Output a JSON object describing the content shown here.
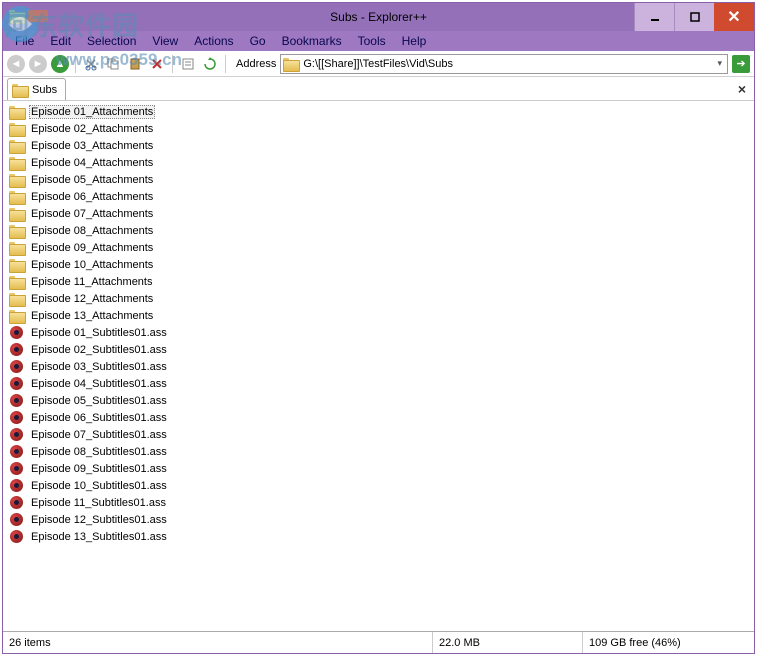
{
  "watermark": {
    "text1": "河东软件园",
    "text2": "www.pc0359.cn"
  },
  "title": "Subs - Explorer++",
  "menu": {
    "file": "File",
    "edit": "Edit",
    "selection": "Selection",
    "view": "View",
    "actions": "Actions",
    "go": "Go",
    "bookmarks": "Bookmarks",
    "tools": "Tools",
    "help": "Help"
  },
  "toolbar": {
    "address_label": "Address",
    "path": "G:\\[[Share]]\\TestFiles\\Vid\\Subs"
  },
  "tab": {
    "label": "Subs"
  },
  "files": {
    "folders": [
      "Episode 01_Attachments",
      "Episode 02_Attachments",
      "Episode 03_Attachments",
      "Episode 04_Attachments",
      "Episode 05_Attachments",
      "Episode 06_Attachments",
      "Episode 07_Attachments",
      "Episode 08_Attachments",
      "Episode 09_Attachments",
      "Episode 10_Attachments",
      "Episode 11_Attachments",
      "Episode 12_Attachments",
      "Episode 13_Attachments"
    ],
    "subs": [
      "Episode 01_Subtitles01.ass",
      "Episode 02_Subtitles01.ass",
      "Episode 03_Subtitles01.ass",
      "Episode 04_Subtitles01.ass",
      "Episode 05_Subtitles01.ass",
      "Episode 06_Subtitles01.ass",
      "Episode 07_Subtitles01.ass",
      "Episode 08_Subtitles01.ass",
      "Episode 09_Subtitles01.ass",
      "Episode 10_Subtitles01.ass",
      "Episode 11_Subtitles01.ass",
      "Episode 12_Subtitles01.ass",
      "Episode 13_Subtitles01.ass"
    ]
  },
  "status": {
    "items": "26 items",
    "size": "22.0 MB",
    "free": "109 GB free (46%)"
  }
}
